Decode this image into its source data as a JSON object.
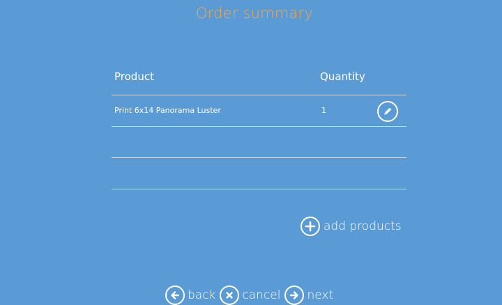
{
  "header": {
    "title": "Order summary"
  },
  "table": {
    "columns": {
      "product": "Product",
      "quantity": "Quantity"
    },
    "rows": [
      {
        "product": "Print 6x14 Panorama Luster",
        "quantity": "1",
        "edit_icon": "pencil-icon"
      },
      {
        "product": "",
        "quantity": ""
      },
      {
        "product": "",
        "quantity": ""
      }
    ]
  },
  "actions": {
    "add_products_label": "add products",
    "add_icon": "plus-circle-icon"
  },
  "nav": {
    "back_label": "back",
    "cancel_label": "cancel",
    "next_label": "next",
    "back_icon": "arrow-left-circle-icon",
    "cancel_icon": "x-circle-icon",
    "next_icon": "arrow-right-circle-icon"
  },
  "colors": {
    "background": "#5b9bd5",
    "title": "#f4a748",
    "text": "#ffffff",
    "divider": "#cfe1f3"
  }
}
